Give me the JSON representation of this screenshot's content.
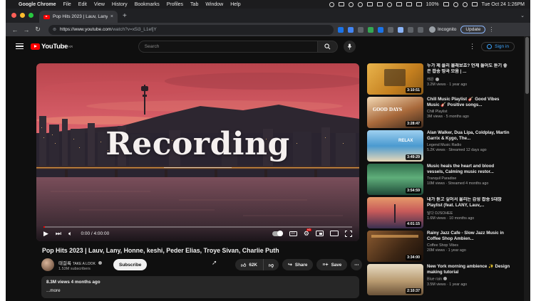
{
  "menubar": {
    "app": "Google Chrome",
    "menus": [
      "File",
      "Edit",
      "View",
      "History",
      "Bookmarks",
      "Profiles",
      "Tab",
      "Window",
      "Help"
    ],
    "battery": "100%",
    "clock": "Tue Oct 24  1:26PM"
  },
  "browser": {
    "tab_title": "Pop Hits 2023 | Lauv, Lany, Ho",
    "url_host": "https://www.youtube.com",
    "url_path": "/watch?v=x5i3_L1efjY",
    "profile": "Incognito",
    "update_label": "Update"
  },
  "youtube": {
    "logo": "YouTube",
    "logo_region": "KR",
    "search_placeholder": "Search",
    "signin": "Sign in"
  },
  "player": {
    "overlay_text": "Recording",
    "time": "0:00 / 4:00:00"
  },
  "video": {
    "title": "Pop Hits 2023 | Lauv, Lany, Honne, keshi, Peder Elias, Troye Sivan, Charlie Puth",
    "channel": "태걸룩",
    "channel_suffix": "TAKE A LOOK",
    "subscribers": "1.53M subscribers",
    "subscribe": "Subscribe",
    "likes": "62K",
    "share": "Share",
    "save": "Save",
    "desc_line1": "8.3M views  4 months ago",
    "desc_more": "...more"
  },
  "recommendations": [
    {
      "title": "누가 제 플리 몰래보죠? 언제 들어도 듣기 좋은 팝송 띵곡 모음 | ...",
      "channel": "래은",
      "meta": "3.2M views · 1 year ago",
      "duration": "3:10:51"
    },
    {
      "title": "Chill Music Playlist 🎸 Good Vibes Music 🎸 Positive songs...",
      "channel": "Chill Playlist",
      "meta": "3M views · 5 months ago",
      "duration": "3:28:47"
    },
    {
      "title": "Alan Walker, Dua Lipa, Coldplay, Martin Garrix & Kygo, The...",
      "channel": "Legend Music Radio",
      "meta": "5.2K views · Streamed 12 days ago",
      "duration": "3:49:29"
    },
    {
      "title": "Music heals the heart and blood vessels, Calming music restor...",
      "channel": "Tranquil Paradise",
      "meta": "10M views · Streamed 4 months ago",
      "duration": "3:54:59"
    },
    {
      "title": "내가 듣고 싶어서 올리는 감성 팝송 5대장 Playlist (feat. LANY, Lauv,...",
      "channel": "달다 DJSOHEE",
      "meta": "1.6M views · 10 months ago",
      "duration": "4:01:15"
    },
    {
      "title": "Rainy Jazz Cafe - Slow Jazz Music in Coffee Shop Ambien...",
      "channel": "Coffee Shop Vibes",
      "meta": "20M views · 1 year ago",
      "duration": "3:34:00"
    },
    {
      "title": "New York morning ambience ✨ Design making tutorial",
      "channel": "Blue rain",
      "meta": "3.5M views · 1 year ago",
      "duration": "2:10:37"
    }
  ],
  "colors": {
    "youtube_red": "#ff0000",
    "link_blue": "#3ea6ff",
    "bg": "#0f0f0f"
  }
}
